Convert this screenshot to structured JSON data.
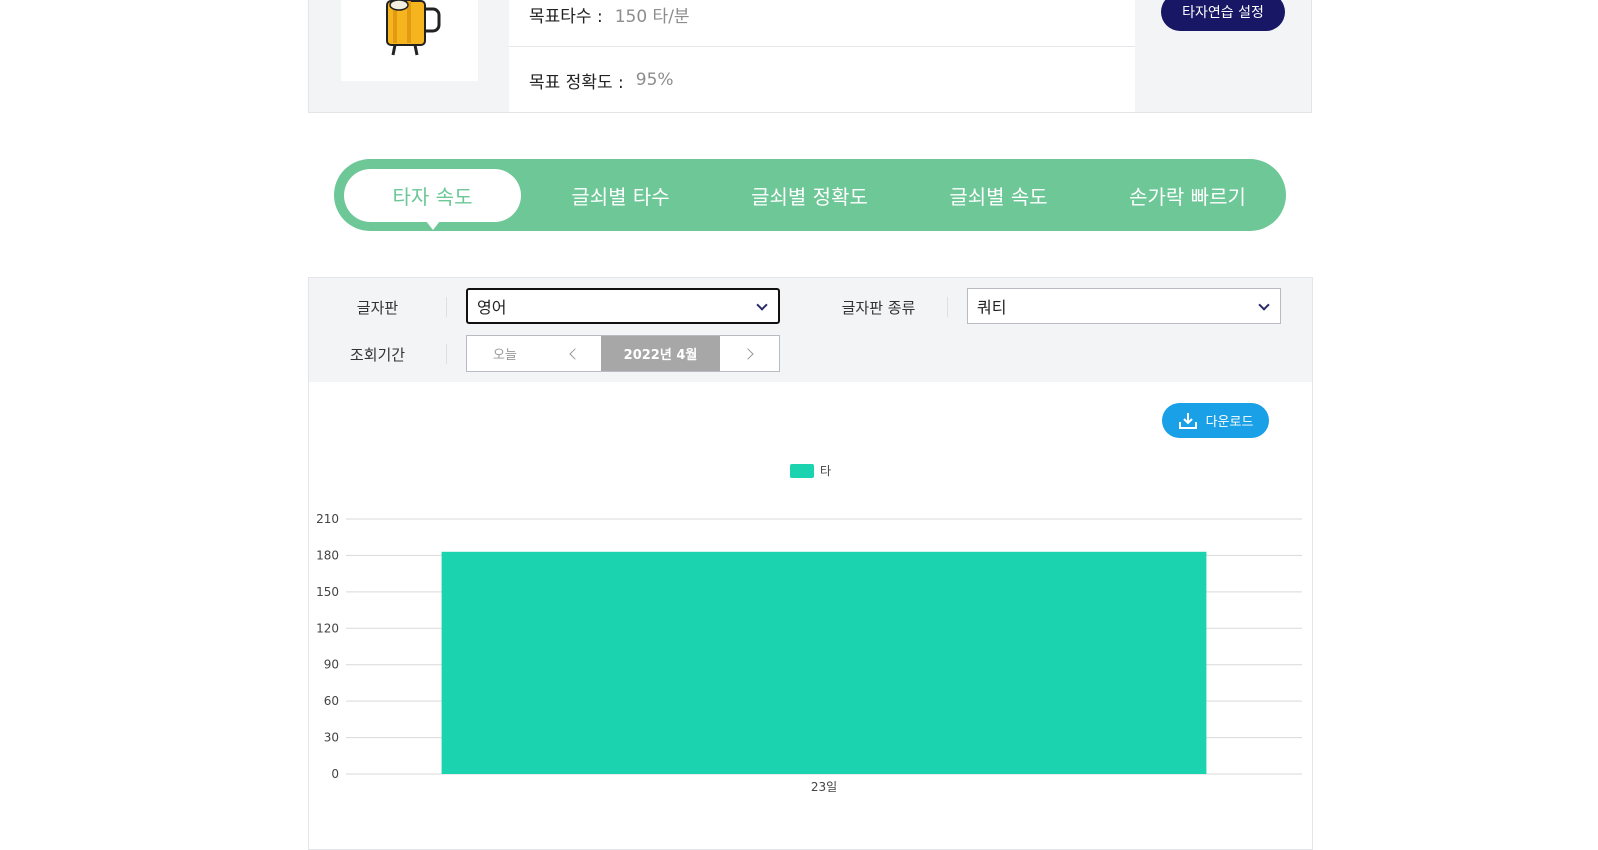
{
  "goals": {
    "typing_speed_label": "목표타수 :",
    "typing_speed_value": "150 타/분",
    "accuracy_label": "목표 정확도 :",
    "accuracy_value": "95%",
    "settings_button": "타자연습 설정"
  },
  "tabs": [
    {
      "label": "타자 속도",
      "active": true
    },
    {
      "label": "글쇠별 타수",
      "active": false
    },
    {
      "label": "글쇠별 정확도",
      "active": false
    },
    {
      "label": "글쇠별 속도",
      "active": false
    },
    {
      "label": "손가락 빠르기",
      "active": false
    }
  ],
  "filters": {
    "keyboard_label": "글자판",
    "keyboard_value": "영어",
    "layout_label": "글자판 종류",
    "layout_value": "쿼티",
    "period_label": "조회기간",
    "today_label": "오늘",
    "current_period": "2022년 4월"
  },
  "download_label": "다운로드",
  "colors": {
    "tab_green": "#6dc797",
    "bar_teal": "#1cd3b0",
    "download_blue": "#1aa0e6",
    "navy_button": "#171766"
  },
  "chart_data": {
    "type": "bar",
    "categories": [
      "23일"
    ],
    "series": [
      {
        "name": "타",
        "values": [
          183
        ]
      }
    ],
    "yticks": [
      "0",
      "30",
      "60",
      "90",
      "120",
      "150",
      "180",
      "210"
    ],
    "ylim": [
      0,
      210
    ],
    "grid": true,
    "legend": "top-center"
  }
}
